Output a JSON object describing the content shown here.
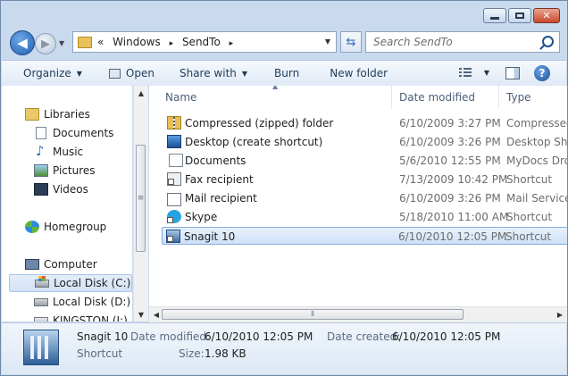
{
  "window": {
    "minimize_glyph": "",
    "close_glyph": "✕"
  },
  "address": {
    "overflow": "«",
    "path": [
      "Windows",
      "SendTo"
    ],
    "separator": "▸"
  },
  "search": {
    "placeholder": "Search SendTo"
  },
  "toolbar": {
    "organize": "Organize",
    "open": "Open",
    "share_with": "Share with",
    "burn": "Burn",
    "new_folder": "New folder"
  },
  "nav": {
    "libraries": "Libraries",
    "documents": "Documents",
    "music": "Music",
    "pictures": "Pictures",
    "videos": "Videos",
    "homegroup": "Homegroup",
    "computer": "Computer",
    "local_c": "Local Disk (C:)",
    "local_d": "Local Disk (D:)",
    "kingston": "KINGSTON (I:)"
  },
  "columns": {
    "name": "Name",
    "date": "Date modified",
    "type": "Type"
  },
  "files": [
    {
      "name": "Compressed (zipped) folder",
      "date": "6/10/2009 3:27 PM",
      "type": "Compressed"
    },
    {
      "name": "Desktop (create shortcut)",
      "date": "6/10/2009 3:26 PM",
      "type": "Desktop Sho"
    },
    {
      "name": "Documents",
      "date": "5/6/2010 12:55 PM",
      "type": "MyDocs Drop"
    },
    {
      "name": "Fax recipient",
      "date": "7/13/2009 10:42 PM",
      "type": "Shortcut"
    },
    {
      "name": "Mail recipient",
      "date": "6/10/2009 3:26 PM",
      "type": "Mail Service"
    },
    {
      "name": "Skype",
      "date": "5/18/2010 11:00 AM",
      "type": "Shortcut"
    },
    {
      "name": "Snagit 10",
      "date": "6/10/2010 12:05 PM",
      "type": "Shortcut"
    }
  ],
  "details": {
    "name": "Snagit 10",
    "kind": "Shortcut",
    "date_modified_label": "Date modified:",
    "date_modified": "6/10/2010 12:05 PM",
    "date_created_label": "Date created:",
    "date_created": "6/10/2010 12:05 PM",
    "size_label": "Size:",
    "size": "1.98 KB"
  }
}
